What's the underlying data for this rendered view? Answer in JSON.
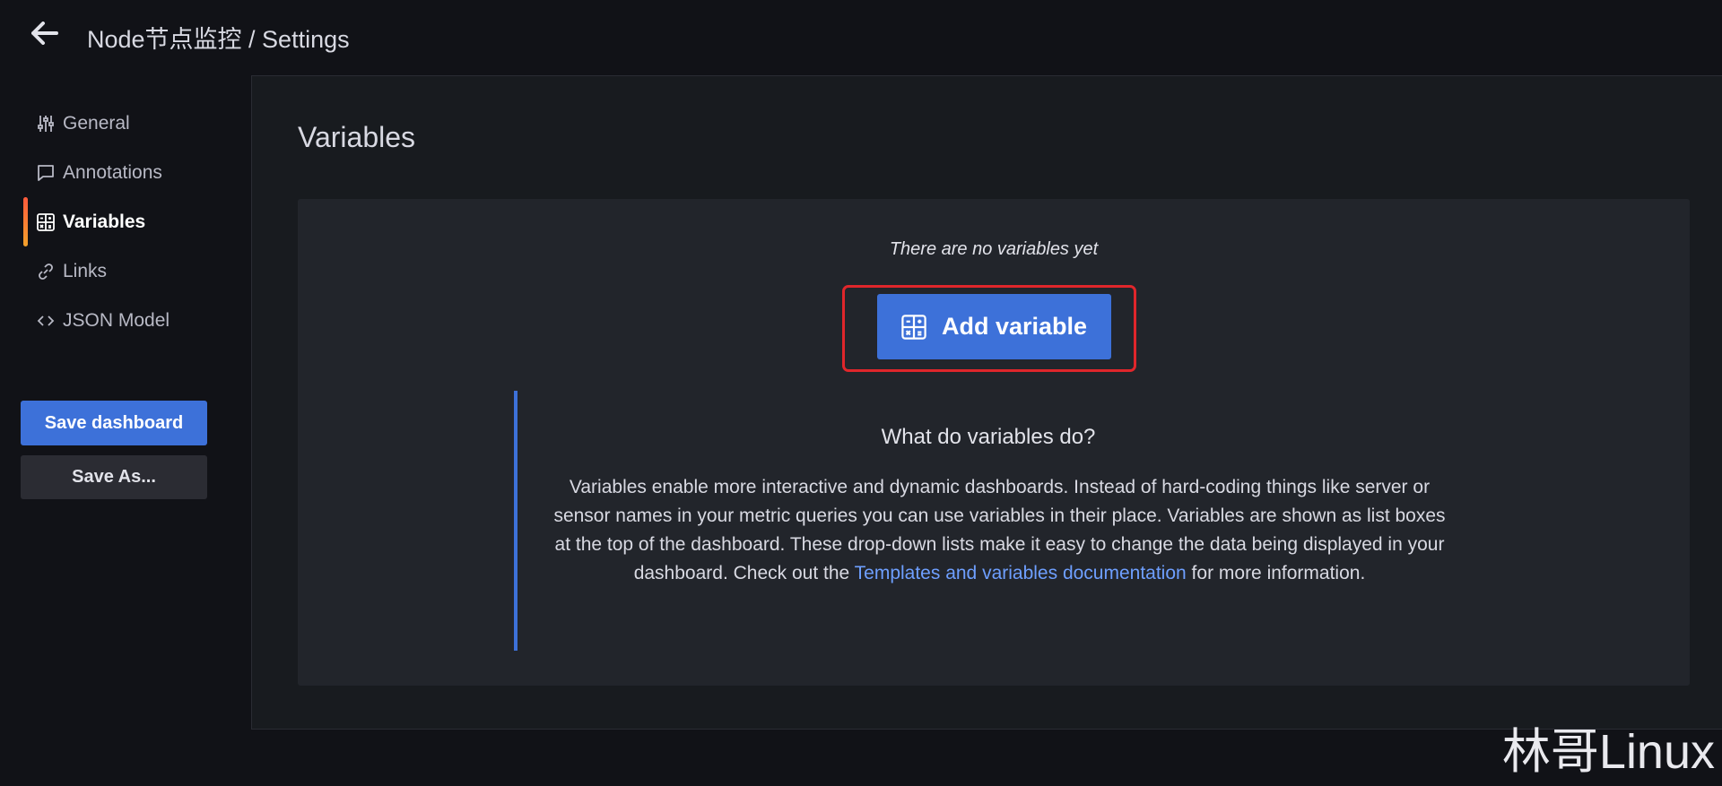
{
  "header": {
    "back_icon": "arrow-left-icon",
    "title": "Node节点监控 / Settings"
  },
  "sidebar": {
    "items": [
      {
        "label": "General",
        "icon": "sliders-icon",
        "active": false
      },
      {
        "label": "Annotations",
        "icon": "comment-icon",
        "active": false
      },
      {
        "label": "Variables",
        "icon": "calculator-icon",
        "active": true
      },
      {
        "label": "Links",
        "icon": "link-icon",
        "active": false
      },
      {
        "label": "JSON Model",
        "icon": "code-icon",
        "active": false
      }
    ],
    "save_label": "Save dashboard",
    "save_as_label": "Save As..."
  },
  "main": {
    "title": "Variables",
    "empty_text": "There are no variables yet",
    "add_button_label": "Add variable",
    "add_button_icon": "calculator-icon",
    "help_title": "What do variables do?",
    "help_text_before": "Variables enable more interactive and dynamic dashboards. Instead of hard-coding things like server or sensor names in your metric queries you can use variables in their place. Variables are shown as list boxes at the top of the dashboard. These drop-down lists make it easy to change the data being displayed in your dashboard. Check out the ",
    "help_link": "Templates and variables documentation",
    "help_text_after": " for more information."
  },
  "watermark": "林哥Linux",
  "colors": {
    "primary": "#3d71d9",
    "highlight": "#e0262b",
    "active_indicator_top": "#ff5a3c",
    "active_indicator_bottom": "#f2a12b",
    "link": "#6e9fff"
  }
}
